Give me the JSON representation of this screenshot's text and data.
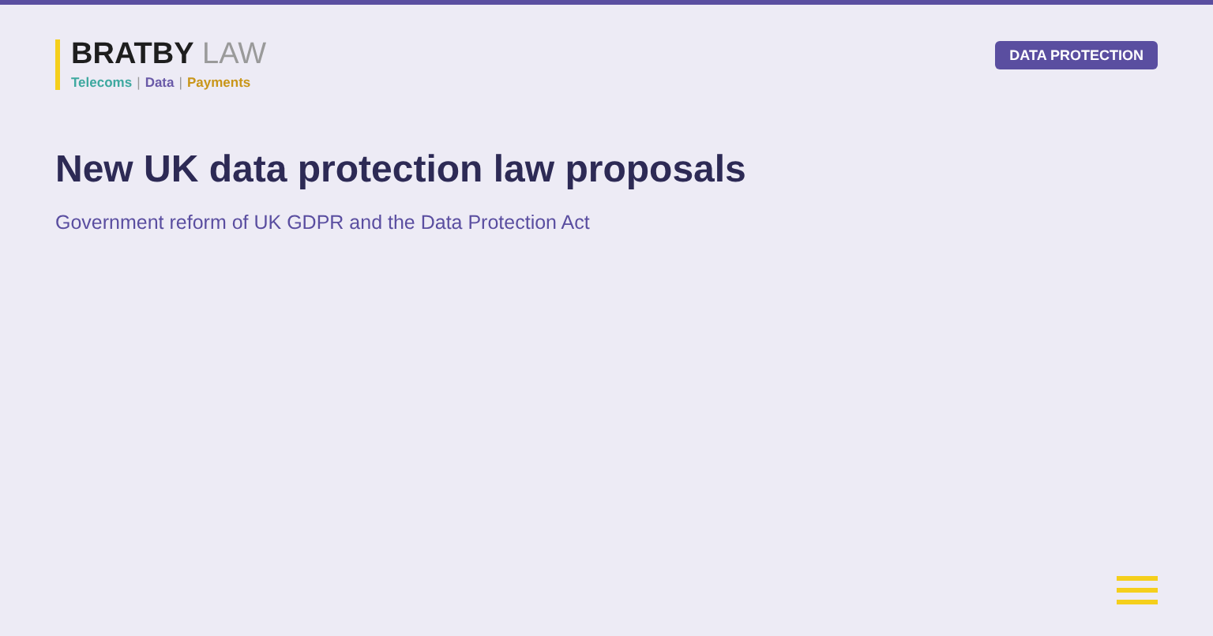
{
  "logo": {
    "name": "BRATBY",
    "suffix": "LAW",
    "tagline": [
      {
        "label": "Telecoms",
        "color": "#3fa9a0"
      },
      {
        "label": "Data",
        "color": "#6a5aa8"
      },
      {
        "label": "Payments",
        "color": "#c9961a"
      }
    ],
    "separator": "|"
  },
  "category_badge": "DATA PROTECTION",
  "title": "New UK data protection law proposals",
  "subtitle": "Government reform of UK GDPR and the Data Protection Act"
}
